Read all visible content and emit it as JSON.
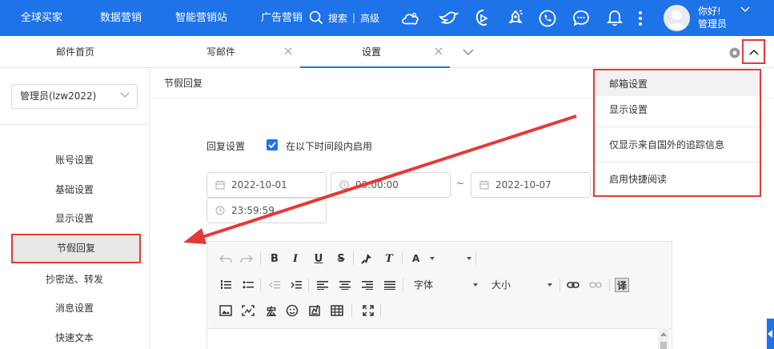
{
  "topbar": {
    "nav": [
      "全球买家",
      "数据营销",
      "智能营销站",
      "广告营销"
    ],
    "search": "搜索",
    "advanced": "高级",
    "greeting": "你好!",
    "user_role": "管理员",
    "icons": [
      "cloud-icon",
      "bird-icon",
      "play-icon",
      "rocket-icon",
      "phone-icon",
      "chat-icon",
      "bell-icon",
      "more-icon"
    ]
  },
  "tabs": {
    "mail_home": "邮件首页",
    "compose": "写邮件",
    "settings": "设置"
  },
  "sidebar": {
    "account": "管理员(lzw2022)",
    "items": [
      "账号设置",
      "基础设置",
      "显示设置",
      "节假回复",
      "抄密送、转发",
      "消息设置",
      "快速文本"
    ]
  },
  "main": {
    "title": "节假回复",
    "reply_label": "回复设置",
    "enable_label": "在以下时间段内启用",
    "start_date": "2022-10-01",
    "start_time": "00:00:00",
    "range_sep": "~",
    "end_date": "2022-10-07",
    "end_time": "23:59:59"
  },
  "editor": {
    "font_color_label": "A",
    "font_family_label": "字体",
    "font_size_label": "大小",
    "translate_label": "译",
    "strike_label": "S",
    "clear_label": "T",
    "code_label": "宏"
  },
  "dropdown": {
    "items": [
      "邮箱设置",
      "显示设置",
      "仅显示来自国外的追踪信息",
      "启用快捷阅读"
    ]
  },
  "colors": {
    "brand": "#1e73e8",
    "annotation": "#e53935"
  }
}
